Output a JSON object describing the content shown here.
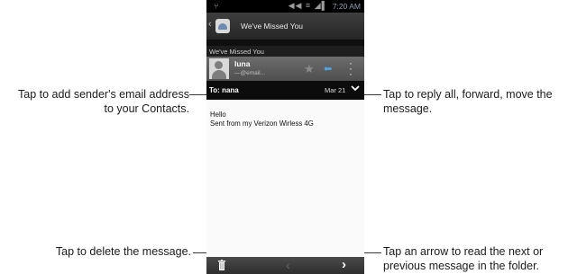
{
  "status_bar": {
    "time": "7:20 AM"
  },
  "header": {
    "title": "We've Missed You"
  },
  "message": {
    "subject": "We've Missed You",
    "sender_name": "luna",
    "sender_email": "—@email...",
    "to_label": "To: nana",
    "date": "Mar 21",
    "body_line1": "Hello",
    "body_line2": "Sent from my Verizon Wirless 4G"
  },
  "icons": {
    "back": "back-chevron",
    "app": "email-app-icon",
    "star": "star-icon",
    "reply": "reply-arrow-icon",
    "more": "more-vertical-icon",
    "expand": "chevron-down-icon",
    "delete": "trash-icon",
    "prev": "prev-arrow-icon",
    "next": "next-arrow-icon"
  },
  "callouts": {
    "add_contact_line1": "Tap to add sender's email address",
    "add_contact_line2": "to your Contacts.",
    "reply_all_line1": "Tap to reply all, forward, move the",
    "reply_all_line2": "message.",
    "delete": "Tap to delete the message.",
    "next_prev_line1": "Tap an arrow to read the next or",
    "next_prev_line2": "previous message in the folder."
  },
  "colors": {
    "accent_blue": "#4fa6e6",
    "screen_bg": "#0f0f0f",
    "body_bg": "#fafafa"
  }
}
